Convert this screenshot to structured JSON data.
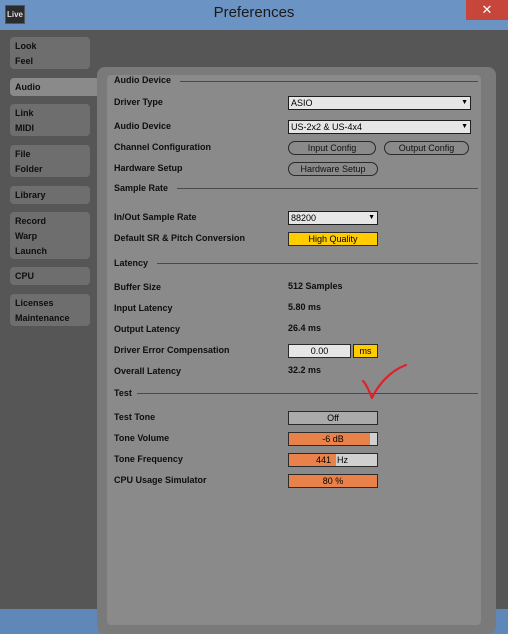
{
  "window": {
    "title": "Preferences",
    "app_icon": "Live",
    "close_label": "✕"
  },
  "sidebar": {
    "items": [
      {
        "lines": [
          "Look",
          "Feel"
        ]
      },
      {
        "lines": [
          "Audio"
        ]
      },
      {
        "lines": [
          "Link",
          "MIDI"
        ]
      },
      {
        "lines": [
          "File",
          "Folder"
        ]
      },
      {
        "lines": [
          "Library"
        ]
      },
      {
        "lines": [
          "Record",
          "Warp",
          "Launch"
        ]
      },
      {
        "lines": [
          "CPU"
        ]
      },
      {
        "lines": [
          "Licenses",
          "Maintenance"
        ]
      }
    ]
  },
  "audio_device": {
    "section": "Audio Device",
    "driver_type_label": "Driver Type",
    "driver_type_value": "ASIO",
    "audio_device_label": "Audio Device",
    "audio_device_value": "US-2x2 & US-4x4",
    "channel_config_label": "Channel Configuration",
    "input_config_button": "Input Config",
    "output_config_button": "Output Config",
    "hardware_setup_label": "Hardware Setup",
    "hardware_setup_button": "Hardware Setup"
  },
  "sample_rate": {
    "section": "Sample Rate",
    "in_out_label": "In/Out Sample Rate",
    "in_out_value": "88200",
    "default_sr_label": "Default SR & Pitch Conversion",
    "default_sr_value": "High Quality"
  },
  "latency": {
    "section": "Latency",
    "buffer_label": "Buffer Size",
    "buffer_value": "512 Samples",
    "input_label": "Input Latency",
    "input_value": "5.80 ms",
    "output_label": "Output Latency",
    "output_value": "26.4 ms",
    "compensation_label": "Driver Error Compensation",
    "compensation_value": "0.00",
    "compensation_unit": "ms",
    "overall_label": "Overall Latency",
    "overall_value": "32.2 ms"
  },
  "test": {
    "section": "Test",
    "tone_label": "Test Tone",
    "tone_value": "Off",
    "volume_label": "Tone Volume",
    "volume_value": "-6 dB",
    "volume_fill": 0.92,
    "frequency_label": "Tone Frequency",
    "frequency_value": "441",
    "frequency_unit": "Hz",
    "cpu_label": "CPU Usage Simulator",
    "cpu_value": "80 %"
  },
  "colors": {
    "accent_orange": "#e8824a",
    "highlight_yellow": "#ffcc00",
    "annotation_red": "#e0202a"
  }
}
